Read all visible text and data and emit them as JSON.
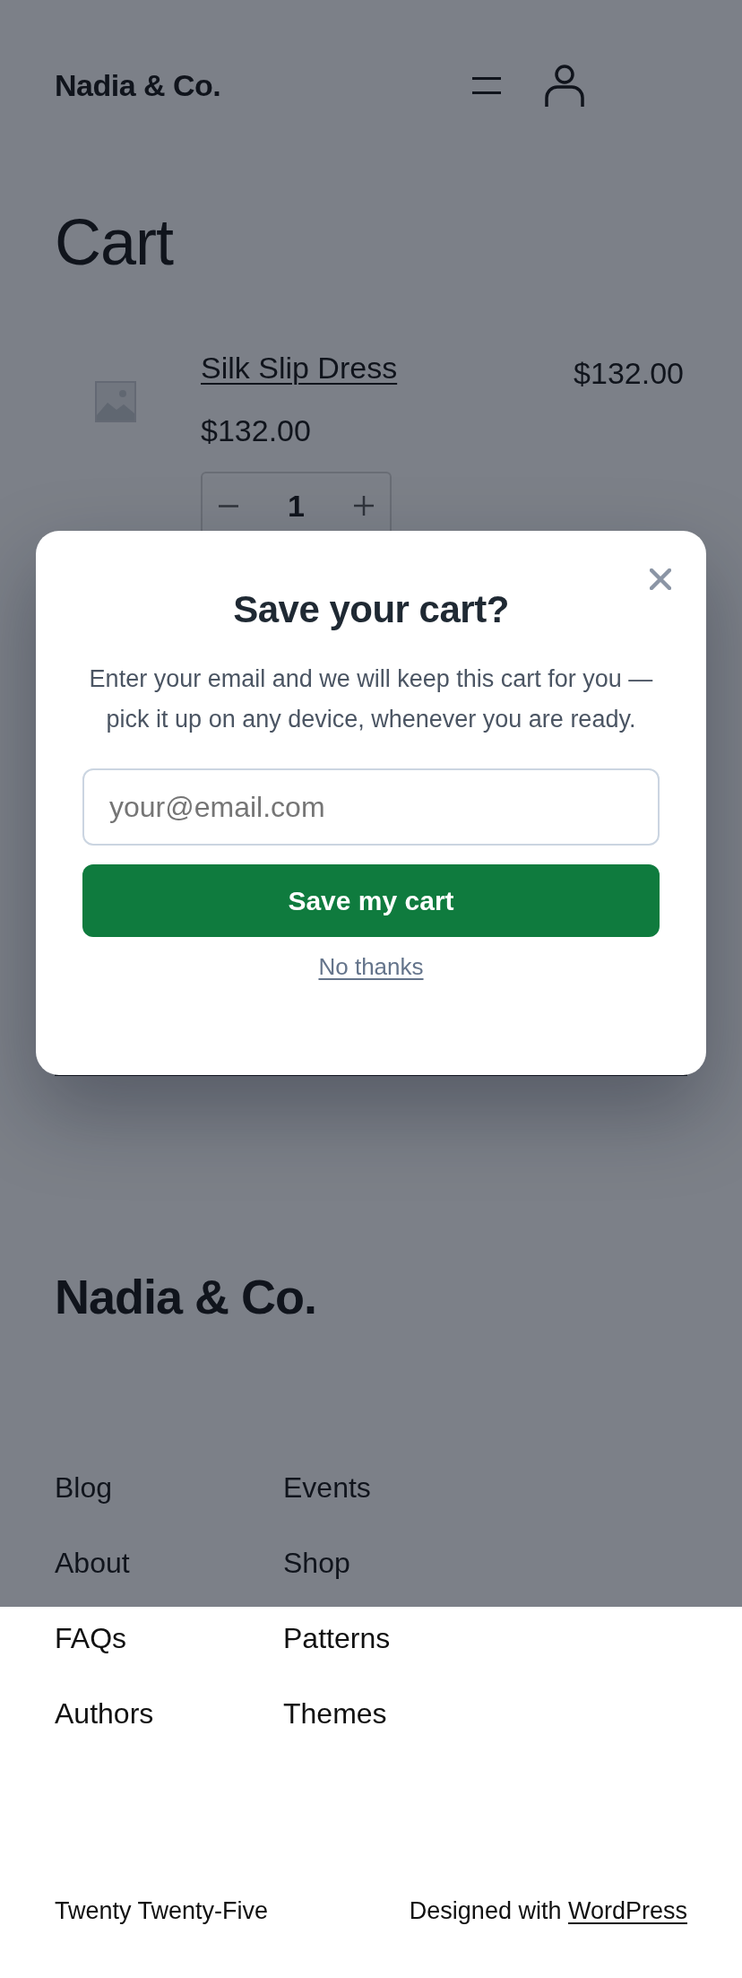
{
  "header": {
    "logo": "Nadia & Co."
  },
  "page_title": "Cart",
  "cart_items": [
    {
      "name": "Silk Slip Dress",
      "price": "$132.00",
      "quantity": "1",
      "total": "$132.00"
    }
  ],
  "save_cart_dialog": {
    "title": "Save your cart?",
    "message": "Enter your email and we will keep this cart for you — pick it up on any device, whenever you are ready.",
    "email_field": {
      "placeholder": "your@email.com"
    },
    "submit_button": "Save my cart",
    "dismiss_link": "No thanks"
  },
  "footer": {
    "logo": "Nadia & Co.",
    "link_columns": [
      [
        "Blog",
        "About",
        "FAQs",
        "Authors"
      ],
      [
        "Events",
        "Shop",
        "Patterns",
        "Themes"
      ]
    ],
    "site_name": "Twenty Twenty-Five",
    "credit": {
      "text": "Designed with",
      "link": "WordPress"
    }
  }
}
